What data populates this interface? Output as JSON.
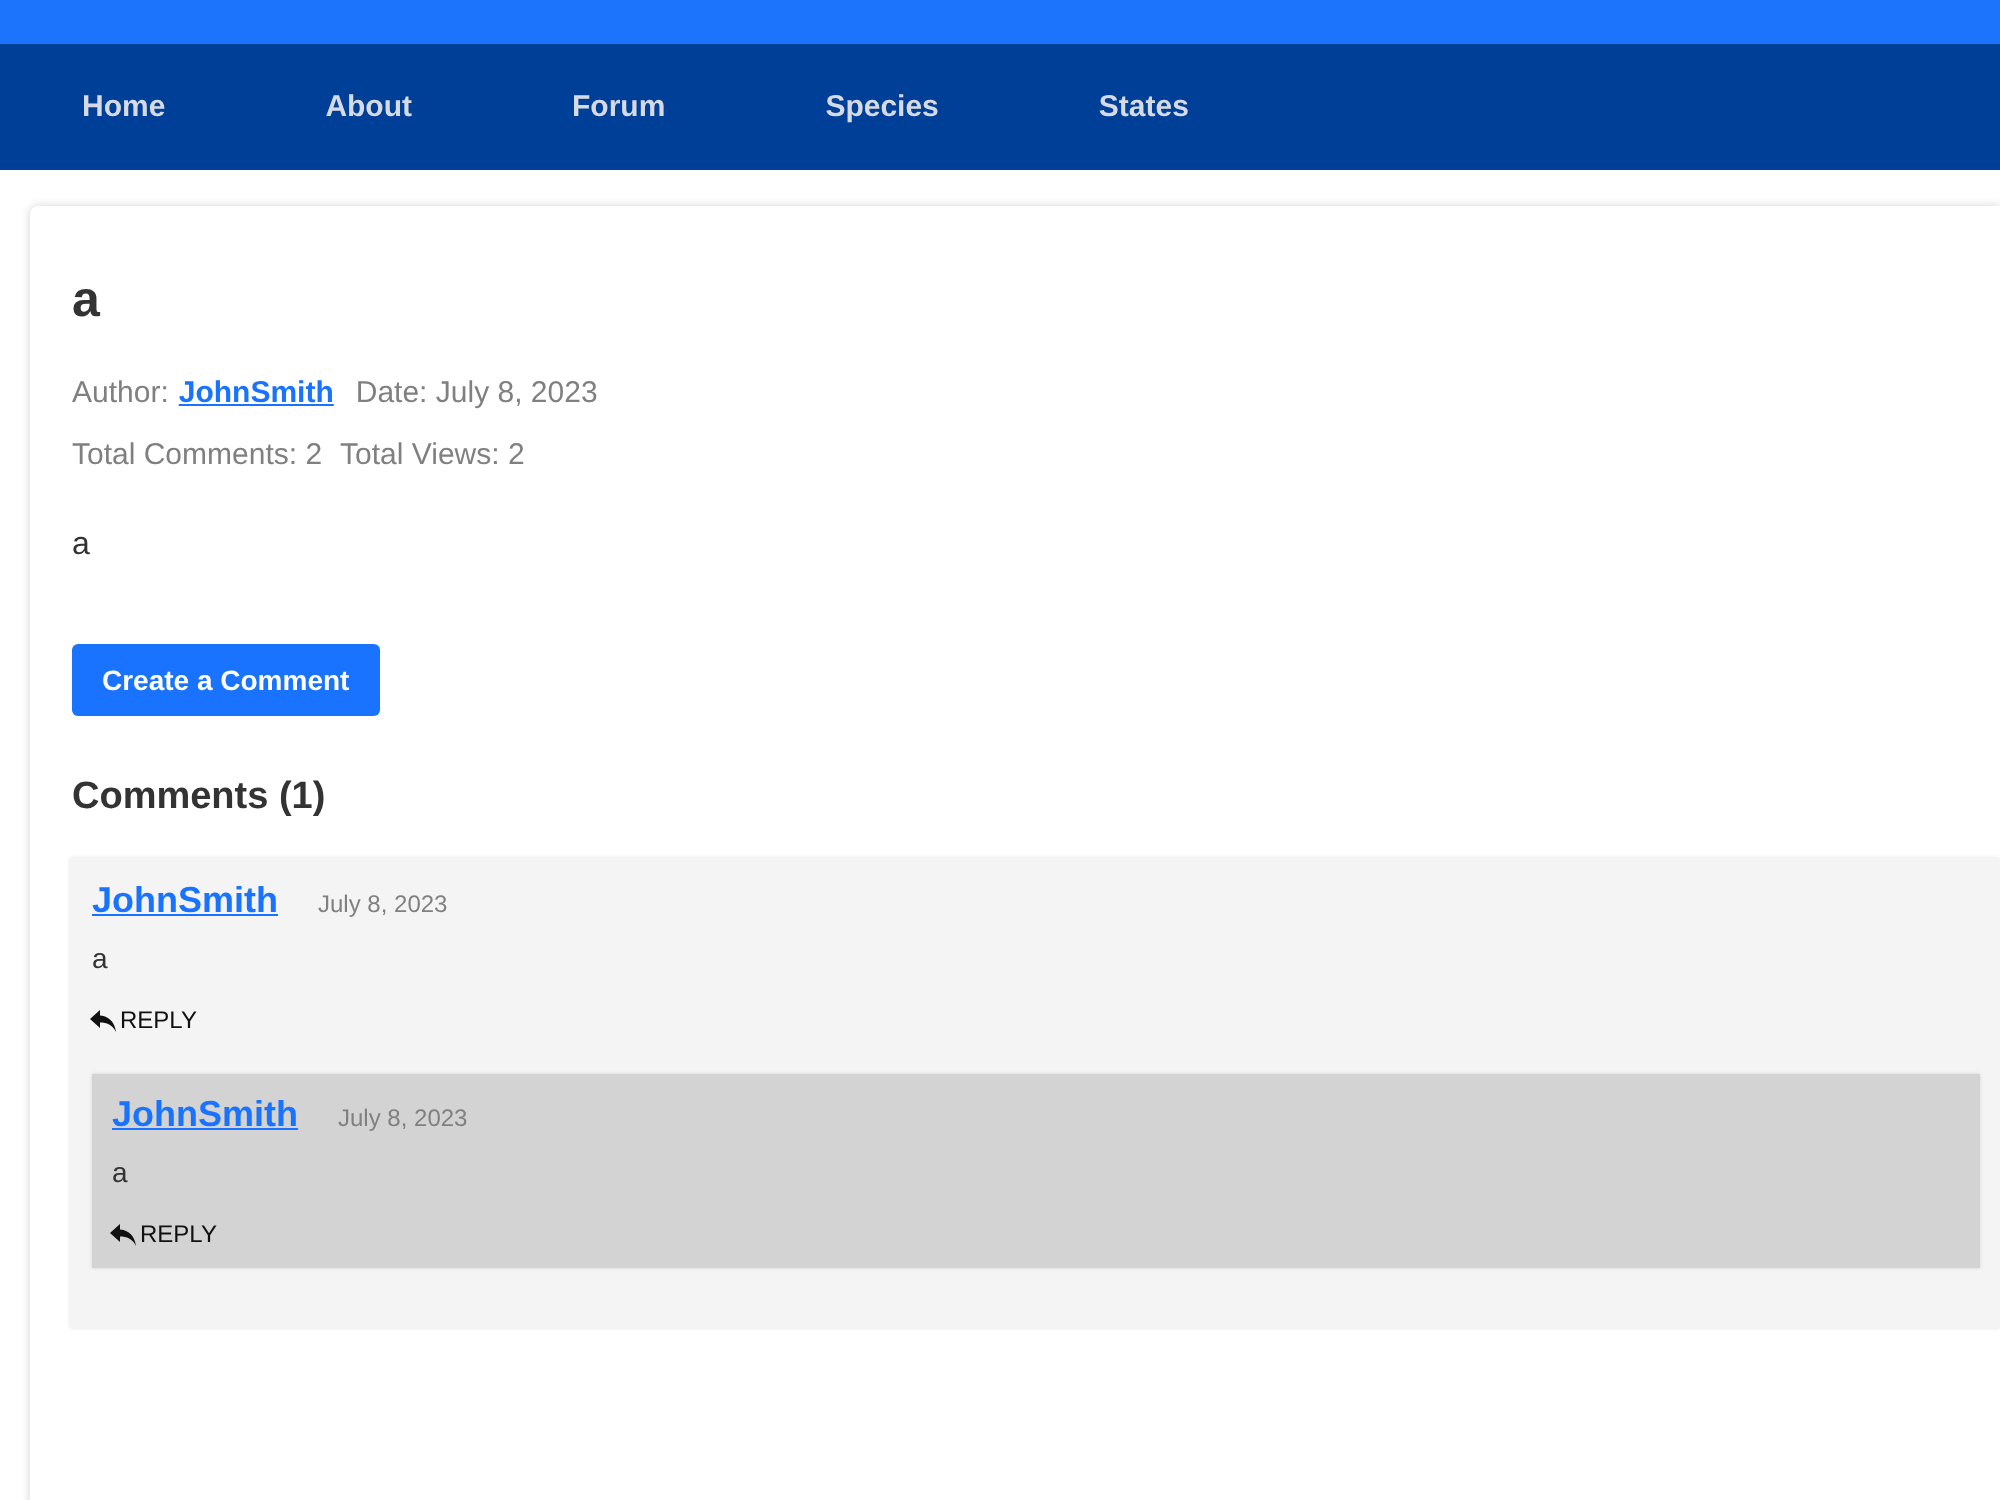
{
  "nav": {
    "items": [
      {
        "label": "Home"
      },
      {
        "label": "About"
      },
      {
        "label": "Forum"
      },
      {
        "label": "Species"
      },
      {
        "label": "States"
      }
    ]
  },
  "post": {
    "title": "a",
    "author_label": "Author:",
    "author": "JohnSmith",
    "date": "Date: July 8, 2023",
    "stats": [
      "Total Comments: 2",
      "Total Views: 2"
    ],
    "body": "a",
    "create_button": "Create a Comment"
  },
  "comments": {
    "heading": "Comments (1)",
    "items": [
      {
        "author": "JohnSmith",
        "date": "July 8, 2023",
        "body": "a",
        "reply_label": "REPLY",
        "children": [
          {
            "author": "JohnSmith",
            "date": "July 8, 2023",
            "body": "a",
            "reply_label": "REPLY"
          }
        ]
      }
    ]
  }
}
